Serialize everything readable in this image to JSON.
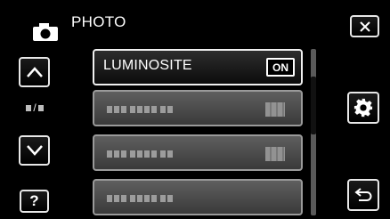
{
  "header": {
    "title": "PHOTO",
    "mode_icon": "camera-icon"
  },
  "nav": {
    "up_icon": "chevron-up-icon",
    "down_icon": "chevron-down-icon",
    "page_indicator": "/",
    "help_label": "?"
  },
  "actions": {
    "close_icon": "close-icon",
    "settings_icon": "gear-icon",
    "back_icon": "return-icon"
  },
  "menu": {
    "items": [
      {
        "label": "LUMINOSITE",
        "value": "ON",
        "selected": true
      },
      {
        "label": "",
        "value": "",
        "selected": false
      },
      {
        "label": "",
        "value": "",
        "selected": false
      },
      {
        "label": "",
        "value": "",
        "selected": false
      }
    ]
  },
  "scroll": {
    "position_fraction": 0.25
  },
  "colors": {
    "background": "#000000",
    "text": "#ffffff",
    "button_border": "#e8e8e8",
    "inactive_item": "#4a4a4a"
  }
}
